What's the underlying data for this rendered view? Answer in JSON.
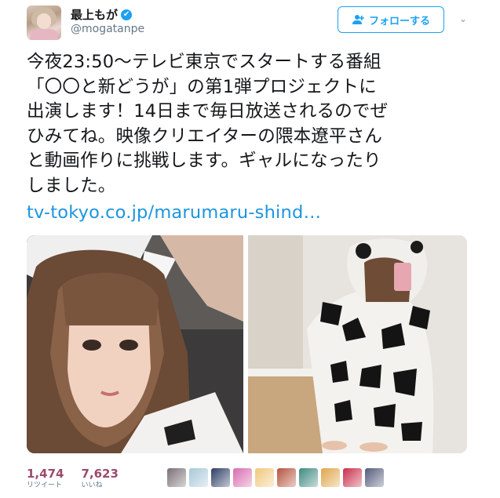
{
  "user": {
    "display_name": "最上もが",
    "handle": "@mogatanpe",
    "verified_icon": "✔"
  },
  "follow_button": {
    "label": "フォローする",
    "icon": "add-person-icon"
  },
  "more_menu": {
    "icon": "chevron-down-icon",
    "glyph": "⌄"
  },
  "tweet": {
    "text": "今夜23:50〜テレビ東京でスタートする番組\n「〇〇と新どうが」の第1弾プロジェクトに\n出演します！14日まで毎日放送されるのでぜ\nひみてね。映像クリエイターの隈本遼平さん\nと動画作りに挑戦します。ギャルになったり\nしました。",
    "link": "tv-tokyo.co.jp/marumaru-shind…"
  },
  "media": [
    {
      "name": "selfie-photo"
    },
    {
      "name": "cow-costume-photo"
    }
  ],
  "stats": {
    "retweets": {
      "count": "1,474",
      "label": "リツイート"
    },
    "likes": {
      "count": "7,623",
      "label": "いいね"
    }
  },
  "likers": [
    {
      "color": "#7a6f75"
    },
    {
      "color": "#a7c8d8"
    },
    {
      "color": "#2f3e66"
    },
    {
      "color": "#d86cb0"
    },
    {
      "color": "#f0c87a"
    },
    {
      "color": "#b5543f"
    },
    {
      "color": "#3d8a80"
    },
    {
      "color": "#e0a64a"
    },
    {
      "color": "#c92f4a"
    },
    {
      "color": "#545a7a"
    }
  ],
  "colors": {
    "accent": "#1da1f2",
    "link": "#1b95e0",
    "stat_number": "#9b4b6b",
    "secondary_text": "#657786"
  }
}
